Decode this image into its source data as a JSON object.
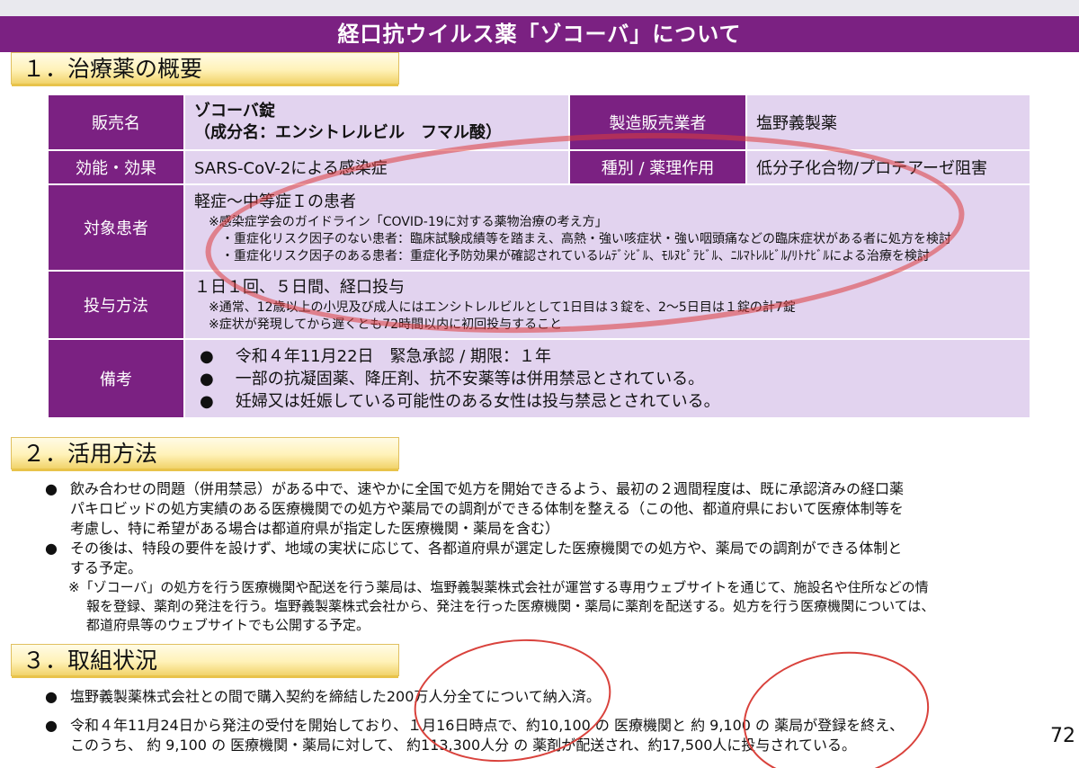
{
  "banner": {
    "title": "経口抗ウイルス薬「ゾコーバ」について"
  },
  "sections": {
    "s1": "１．治療薬の概要",
    "s2": "２．活用方法",
    "s3": "３．取組状況"
  },
  "table": {
    "hanbai_label": "販売名",
    "hanbai_line1": "ゾコーバ錠",
    "hanbai_line2": "（成分名：エンシトレルビル　フマル酸）",
    "maker_label": "製造販売業者",
    "maker_value": "塩野義製薬",
    "kouka_label": "効能・効果",
    "kouka_value": "SARS-CoV-2による感染症",
    "shubetsu_label": "種別 / 薬理作用",
    "shubetsu_value": "低分子化合物/プロテアーゼ阻害",
    "taisho_label": "対象患者",
    "taisho_main": "軽症～中等症Ｉの患者",
    "taisho_note1": "※感染症学会のガイドライン「COVID-19に対する薬物治療の考え方」",
    "taisho_note2": "・重症化リスク因子のない患者：臨床試験成績等を踏まえ、高熱・強い咳症状・強い咽頭痛などの臨床症状がある者に処方を検討",
    "taisho_note3": "・重症化リスク因子のある患者：重症化予防効果が確認されているﾚﾑﾃﾞｼﾋﾞﾙ、ﾓﾙﾇﾋﾟﾗﾋﾞﾙ、ﾆﾙﾏﾄﾚﾙﾋﾞﾙ/ﾘﾄﾅﾋﾞﾙによる治療を検討",
    "toyo_label": "投与方法",
    "toyo_main": "１日１回、５日間、経口投与",
    "toyo_note1": "※通常、12歳以上の小児及び成人にはエンシトレルビルとして1日目は３錠を、2～5日目は１錠の計7錠",
    "toyo_note2": "※症状が発現してから遅くとも72時間以内に初回投与すること",
    "biko_label": "備考",
    "biko_items": [
      "令和４年11月22日　緊急承認 / 期限：１年",
      "一部の抗凝固薬、降圧剤、抗不安薬等は併用禁忌とされている。",
      "妊婦又は妊娠している可能性のある女性は投与禁忌とされている。"
    ]
  },
  "katsuyo": {
    "p1_l1": "飲み合わせの問題（併用禁忌）がある中で、速やかに全国で処方を開始できるよう、最初の２週間程度は、既に承認済みの経口薬",
    "p1_l2": "パキロビッドの処方実績のある医療機関での処方や薬局での調剤ができる体制を整える（この他、都道府県において医療体制等を",
    "p1_l3": "考慮し、特に希望がある場合は都道府県が指定した医療機関・薬局を含む）",
    "p2_l1": "その後は、特段の要件を設けず、地域の実状に応じて、各都道府県が選定した医療機関での処方や、薬局での調剤ができる体制と",
    "p2_l2": "する予定。",
    "n_l1": "※「ゾコーバ」の処方を行う医療機関や配送を行う薬局は、塩野義製薬株式会社が運営する専用ウェブサイトを通じて、施設名や住所などの情",
    "n_l2": "報を登録、薬剤の発注を行う。塩野義製薬株式会社から、発注を行った医療機関・薬局に薬剤を配送する。処方を行う医療機関については、",
    "n_l3": "都道府県等のウェブサイトでも公開する予定。"
  },
  "torikumi": {
    "p1": "塩野義製薬株式会社との間で購入契約を締結した200万人分全てについて納入済。",
    "p2_l1": "令和４年11月24日から発注の受付を開始しており、１月16日時点で、約10,100 の 医療機関と 約 9,100 の 薬局が登録を終え、",
    "p2_l2": "このうち、 約 9,100 の 医療機関・薬局に対して、 約113,300人分 の 薬剤が配送され、約17,500人に投与されている。"
  },
  "bullet": "●",
  "page_number": "72"
}
